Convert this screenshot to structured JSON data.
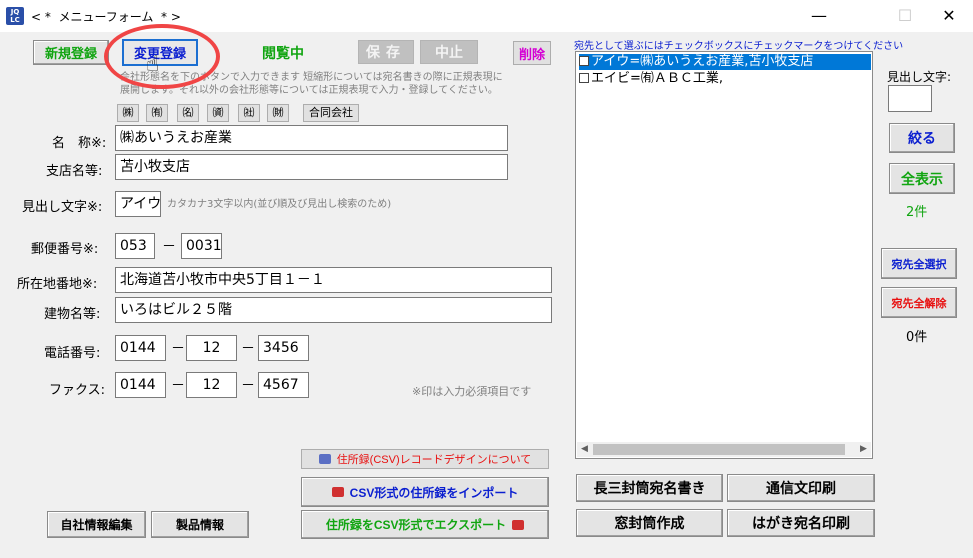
{
  "window": {
    "icon_text": "JQ LC",
    "title": "< *  メニューフォーム  * >",
    "minimize": "—",
    "maximize": "☐",
    "close": "✕"
  },
  "toolbar": {
    "new_label": "新規登録",
    "update_label": "変更登録",
    "mode_label": "閲覧中",
    "save_label": "保存",
    "cancel_label": "中止",
    "delete_label": "削除"
  },
  "hints": {
    "company_form_line1": "会社形態名を下のボタンで入力できます 短縮形については宛名書きの際に正規表現に",
    "company_form_line2": "展開します。それ以外の会社形態等については正規表現で入力・登録してください。",
    "kana_hint": "カタカナ3文字以内(並び順及び見出し検索のため)",
    "required_note": "※印は入力必須項目です"
  },
  "prefixes": [
    "㈱",
    "㈲",
    "㈴",
    "㈾",
    "㈳",
    "㈶",
    "合同会社"
  ],
  "form": {
    "name_label": "名　称※:",
    "name_value": "㈱あいうえお産業",
    "branch_label": "支店名等:",
    "branch_value": "苫小牧支店",
    "kana_label": "見出し文字※:",
    "kana_value": "アイウ",
    "zip_label": "郵便番号※:",
    "zip1": "053",
    "zip2": "0031",
    "address_label": "所在地番地※:",
    "address_value": "北海道苫小牧市中央5丁目１－１",
    "building_label": "建物名等:",
    "building_value": "いろはビル２５階",
    "phone_label": "電話番号:",
    "phone1": "0144",
    "phone2": "12",
    "phone3": "3456",
    "fax_label": "ファクス:",
    "fax1": "0144",
    "fax2": "12",
    "fax3": "4567",
    "dash": "－"
  },
  "bottom_left": {
    "company_info": "自社情報編集",
    "product_info": "製品情報",
    "csv_design": "住所録(CSV)レコードデザインについて",
    "csv_import": "CSV形式の住所録をインポート",
    "csv_export": "住所録をCSV形式でエクスポート"
  },
  "recipients": {
    "caption": "宛先として選ぶにはチェックボックスにチェックマークをつけてください",
    "items": [
      "アイウ=㈱あいうえお産業,苫小牧支店",
      "エイビ=㈲ＡＢＣ工業,"
    ]
  },
  "print_buttons": {
    "long_envelope": "長三封筒宛名書き",
    "letter_print": "通信文印刷",
    "window_envelope": "窓封筒作成",
    "postcard_print": "はがき宛名印刷"
  },
  "right_panel": {
    "search_label": "見出し文字:",
    "search_value": "",
    "filter_button": "絞る",
    "show_all_button": "全表示",
    "count_all": "2件",
    "select_all_button": "宛先全選択",
    "clear_all_button": "宛先全解除",
    "count_selected": "0件"
  },
  "colors": {
    "green": "#11a511",
    "blue": "#0b1fd0",
    "red": "#e81010",
    "magenta": "#d400d4",
    "selection": "#0078d7",
    "annotation_circle": "#f04545"
  }
}
